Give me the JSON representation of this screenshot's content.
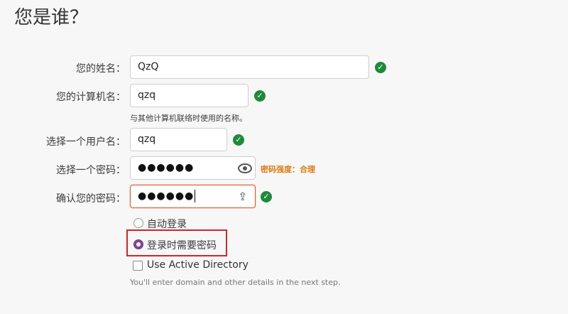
{
  "page": {
    "title": "您是谁？"
  },
  "fields": {
    "name": {
      "label": "您的姓名：",
      "value": "QzQ"
    },
    "computer": {
      "label": "您的计算机名：",
      "value": "qzq",
      "hint": "与其他计算机联络时使用的名称。"
    },
    "username": {
      "label": "选择一个用户名：",
      "value": "qzq"
    },
    "password": {
      "label": "选择一个密码：",
      "value": "●●●●●●",
      "strength": "密码强度：合理"
    },
    "confirm": {
      "label": "确认您的密码：",
      "value": "●●●●●●"
    }
  },
  "login": {
    "auto_login": "自动登录",
    "require_password": "登录时需要密码",
    "selected": "require_password"
  },
  "active_directory": {
    "label": "Use Active Directory",
    "checked": false,
    "hint": "You'll enter domain and other details in the next step."
  },
  "icons": {
    "valid": "check-circle-icon",
    "reveal": "eye-icon",
    "capslock": "capslock-icon"
  },
  "colors": {
    "valid": "#1f8a3a",
    "strength": "#e07a10",
    "radio_selected": "#86478f",
    "focus_border": "#e95420",
    "highlight": "#d3232a"
  }
}
